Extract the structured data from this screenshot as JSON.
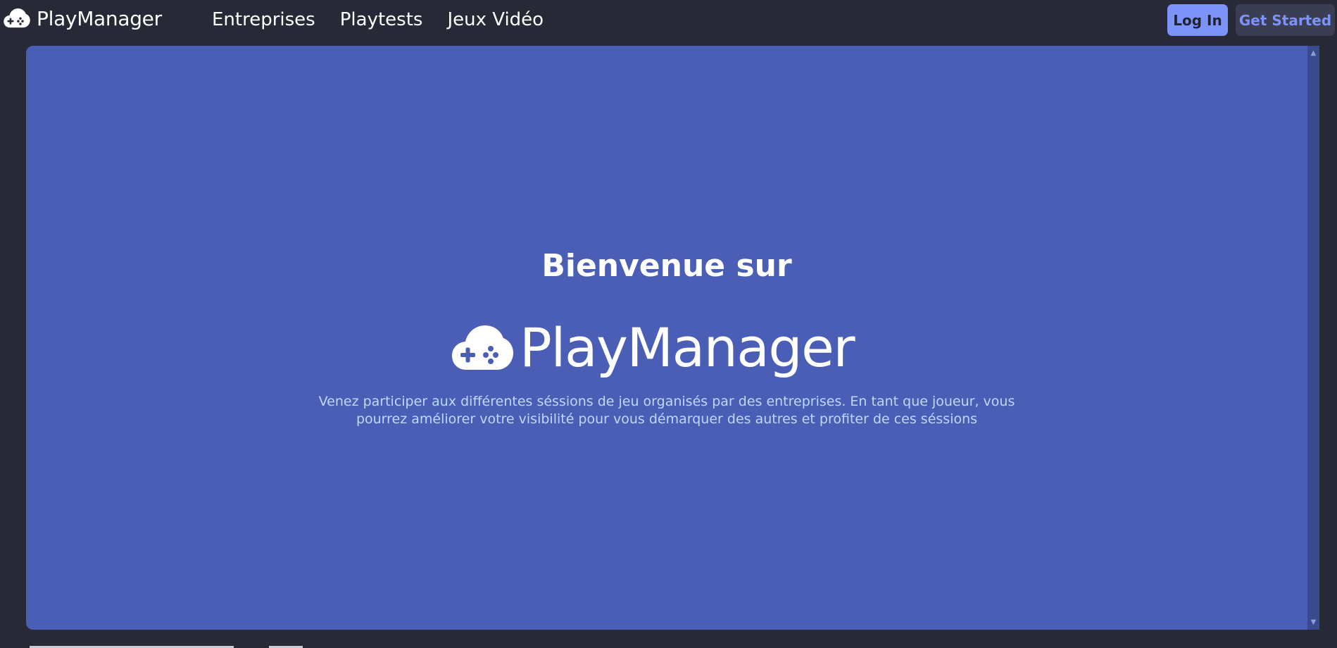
{
  "navbar": {
    "brand": {
      "name": "PlayManager",
      "icon": "gamepad-cloud-icon"
    },
    "links": [
      {
        "label": "Entreprises"
      },
      {
        "label": "Playtests"
      },
      {
        "label": "Jeux Vidéo"
      }
    ],
    "login_label": "Log In",
    "get_started_label": "Get Started"
  },
  "hero": {
    "title": "Bienvenue sur",
    "logo_text": "PlayManager",
    "logo_icon": "gamepad-cloud-icon",
    "description": "Venez participer aux différentes séssions de jeu organisés par des entreprises. En tant que joueur, vous pourrez améliorer votre visibilité pour vous démarquer des autres et profiter de ces séssions"
  },
  "scrollbar": {
    "up_icon": "scroll-up-arrow-icon",
    "down_icon": "scroll-down-arrow-icon"
  },
  "colors": {
    "background": "#272936",
    "panel": "#4b5eb6",
    "accent": "#7c93fa",
    "secondary_button": "#3b3e52",
    "description_text": "#b7dcff"
  }
}
